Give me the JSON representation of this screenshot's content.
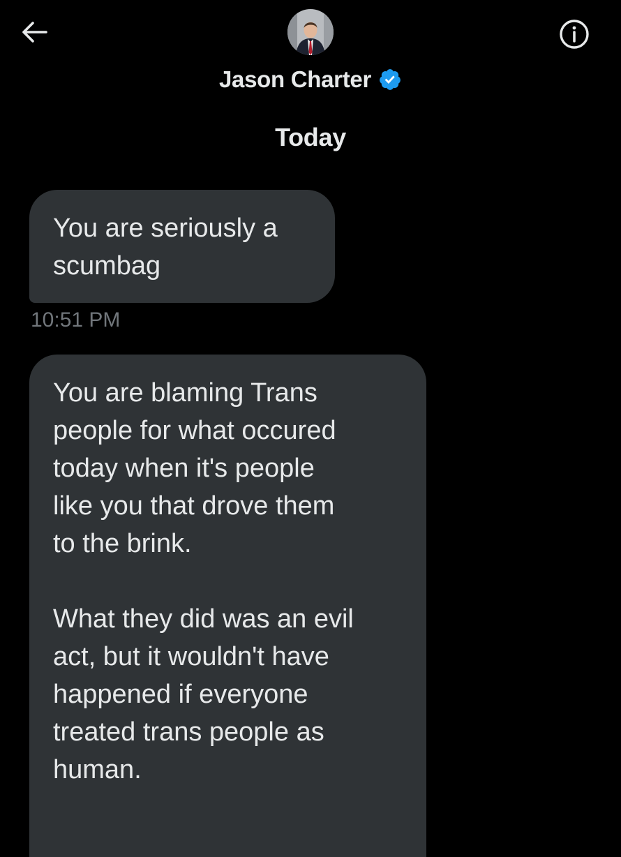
{
  "header": {
    "back_icon": "arrow-left-icon",
    "info_icon": "info-circle-icon",
    "contact": {
      "name": "Jason Charter",
      "verified_icon": "verified-badge-icon",
      "verified_color": "#1d9bf0",
      "avatar": "avatar-photo"
    }
  },
  "conversation": {
    "date_divider": "Today",
    "messages": [
      {
        "text": "You are seriously a\nscumbag",
        "time": "10:51 PM"
      },
      {
        "text": "You are blaming Trans\npeople for what occured\ntoday when it's people\nlike you that drove them\nto the brink.\n\nWhat they did was an evil\nact, but it wouldn't have\nhappened if everyone\ntreated trans people as\nhuman."
      }
    ]
  },
  "colors": {
    "background": "#000000",
    "bubble": "#2f3336",
    "text": "#e7e9ea",
    "muted_text": "#71767b",
    "accent": "#1d9bf0"
  }
}
